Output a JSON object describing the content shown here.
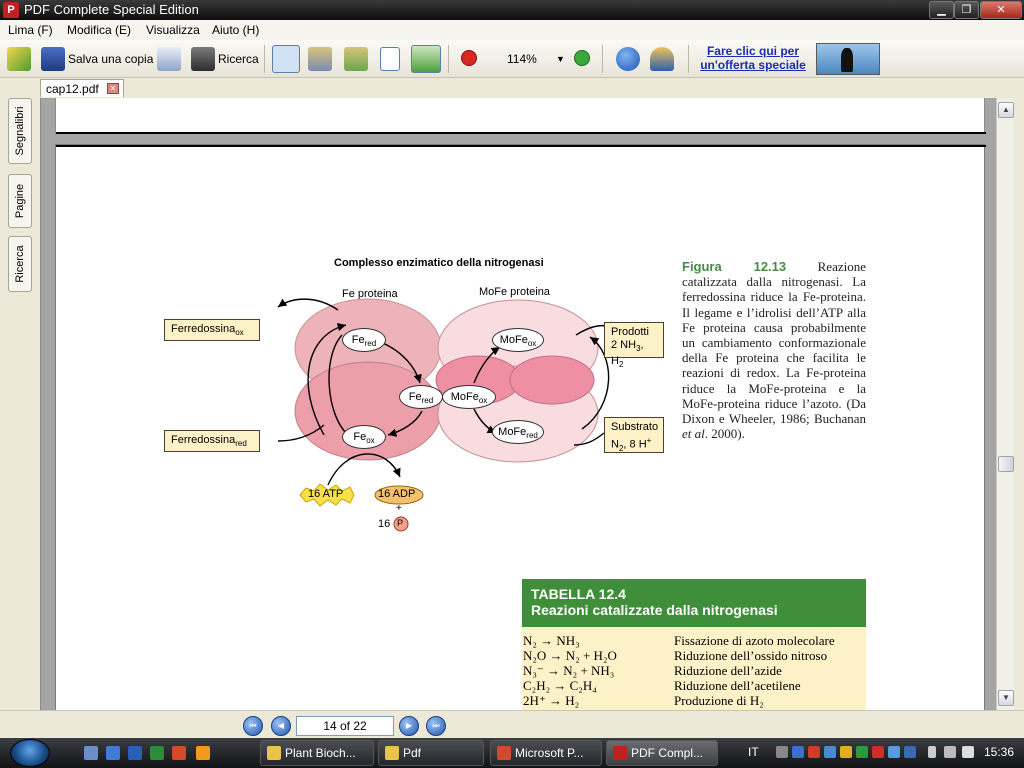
{
  "window": {
    "title": "PDF Complete Special Edition",
    "logo_text": "P"
  },
  "menu": [
    "Lima (F)",
    "Modifica (E)",
    "Visualizza",
    "Aiuto (H)"
  ],
  "toolbar": {
    "save_copy": "Salva una copia",
    "search": "Ricerca",
    "zoom": "114%",
    "promo_line1": "Fare clic qui per",
    "promo_line2": "un'offerta speciale"
  },
  "tab": {
    "label": "cap12.pdf"
  },
  "sidetabs": [
    "Segnalibri",
    "Pagine",
    "Ricerca"
  ],
  "navigation": {
    "page_display": "14 of 22"
  },
  "figure": {
    "title": "Complesso enzimatico della nitrogenasi",
    "fe_label": "Fe proteina",
    "mofe_label": "MoFe proteina",
    "ferredoxin_ox": "Ferredossina",
    "ferredoxin_ox_sub": "ox",
    "ferredoxin_red": "Ferredossina",
    "ferredoxin_red_sub": "red",
    "fe_red_top": "Fe",
    "fe_red_top_sub": "red",
    "fe_red_mid": "Fe",
    "fe_red_mid_sub": "red",
    "fe_ox": "Fe",
    "fe_ox_sub": "ox",
    "mofe_ox_top": "MoFe",
    "mofe_ox_top_sub": "ox",
    "mofe_ox_mid": "MoFe",
    "mofe_ox_mid_sub": "ox",
    "mofe_red": "MoFe",
    "mofe_red_sub": "red",
    "products_l1": "Prodotti",
    "products_l2": "2 NH",
    "products_sub": "3",
    "products_l2b": ", H",
    "products_sub2": "2",
    "substrate_l1": "Substrato",
    "substrate_l2": "N",
    "substrate_sub": "2",
    "substrate_l2b": ", 8 H",
    "substrate_sup": "+",
    "atp": "16 ATP",
    "adp": "16 ADP",
    "plus": "+",
    "pi_num": "16",
    "pi": "P",
    "colors": {
      "fe_protein": "#eeb3b9",
      "mofe_protein": "#f8dcdf",
      "mofe_core": "#ef8fa4",
      "box_fill": "#fdf1c7",
      "atp_fill": "#f7e04a",
      "adp_fill": "#f4c06b",
      "pi_fill": "#f4a08a"
    }
  },
  "caption": {
    "label": "Figura 12.13",
    "text_before_italic": " Reazione catalizzata dalla nitrogenasi. La ferredossina riduce la Fe-proteina. Il legame e l’idrolisi dell’ATP alla Fe proteina causa probabilmente un cambiamento conformazionale della Fe proteina che facilita le reazioni di redox. La Fe-proteina riduce la MoFe-proteina e la MoFe-proteina riduce l’azoto. (Da Dixon e Wheeler, 1986; Buchanan ",
    "italic": "et al",
    "text_after_italic": ". 2000)."
  },
  "table": {
    "label": "TABELLA 12.4",
    "title": "Reazioni catalizzate dalla nitrogenasi",
    "rows": [
      {
        "reaction": "N₂ → NH₃",
        "description": "Fissazione di azoto molecolare"
      },
      {
        "reaction": "N₂O → N₂ + H₂O",
        "description": "Riduzione dell’ossido nitroso"
      },
      {
        "reaction": "N₃⁻ → N₂ + NH₃",
        "description": "Riduzione dell’azide"
      },
      {
        "reaction": "C₂H₂ → C₂H₄",
        "description": "Riduzione dell’acetilene"
      },
      {
        "reaction": "2H⁺ → H₂",
        "description": "Produzione di H₂"
      }
    ],
    "header_color": "#3f8f3a"
  },
  "taskbar": {
    "tasks": [
      "Plant Bioch...",
      "Pdf",
      "Microsoft P...",
      "PDF Compl..."
    ],
    "language": "IT",
    "clock": "15:36"
  }
}
